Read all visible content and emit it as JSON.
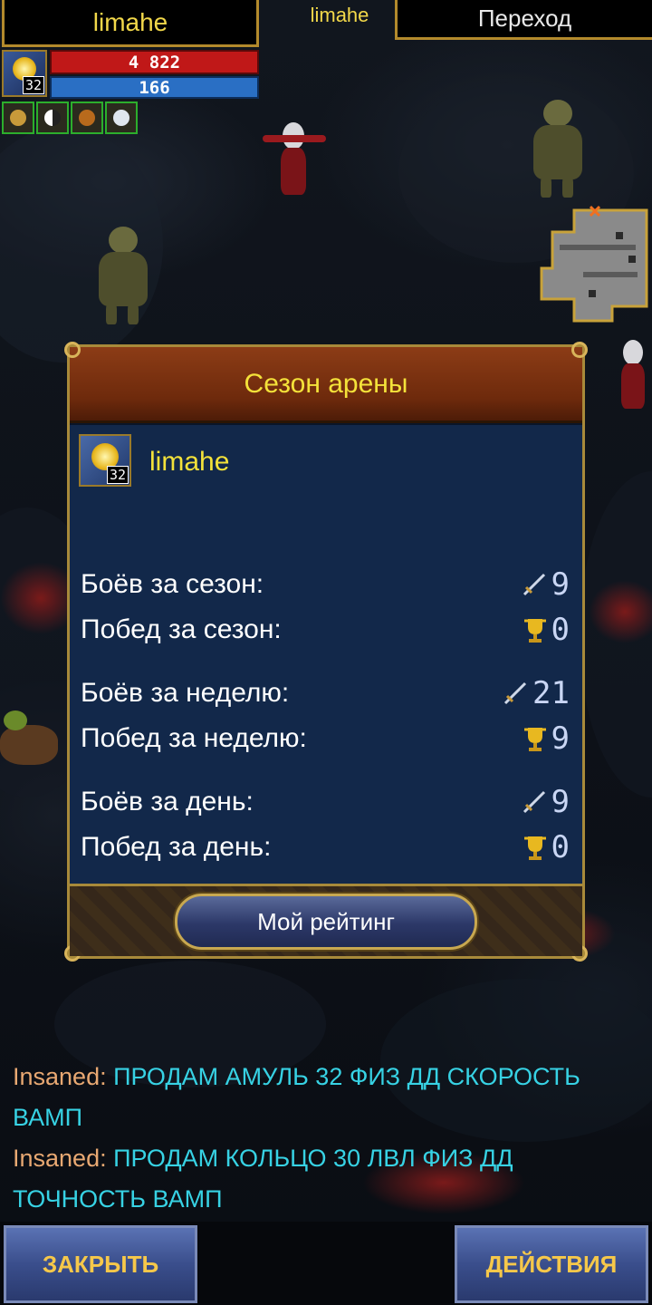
{
  "hud": {
    "player_name": "limahe",
    "center_name": "limahe",
    "goto_label": "Переход",
    "level": "32",
    "hp": "4 822",
    "mp": "166",
    "buff_icons": [
      "shield-buff-icon",
      "yin-yang-buff-icon",
      "beast-buff-icon",
      "wolf-buff-icon"
    ]
  },
  "dialog": {
    "title": "Сезон арены",
    "player": {
      "name": "limahe",
      "level": "32"
    },
    "stats": [
      {
        "label": "Боёв за сезон:",
        "icon": "sword-icon",
        "value": "9"
      },
      {
        "label": "Побед за сезон:",
        "icon": "trophy-icon",
        "value": "0"
      },
      {
        "label": "Боёв за неделю:",
        "icon": "sword-icon",
        "value": "21"
      },
      {
        "label": "Побед за неделю:",
        "icon": "trophy-icon",
        "value": "9"
      },
      {
        "label": "Боёв за день:",
        "icon": "sword-icon",
        "value": "9"
      },
      {
        "label": "Побед за день:",
        "icon": "trophy-icon",
        "value": "0"
      }
    ],
    "rating_button": "Мой рейтинг"
  },
  "chat": [
    {
      "sender": "Insaned:",
      "message": " ПРОДАМ АМУЛЬ 32 ФИЗ ДД СКОРОСТЬ ВАМП"
    },
    {
      "sender": "Insaned:",
      "message": " ПРОДАМ КОЛЬЦО 30 ЛВЛ ФИЗ ДД ТОЧНОСТЬ ВАМП"
    }
  ],
  "buttons": {
    "close": "ЗАКРЫТЬ",
    "actions": "ДЕЙСТВИЯ"
  },
  "colors": {
    "accent_gold": "#f4e23a",
    "hp_red": "#c01818",
    "mp_blue": "#2a6fc4",
    "chat_sender": "#e8a872",
    "chat_message": "#37d2e4",
    "button_text": "#f6c84a"
  }
}
